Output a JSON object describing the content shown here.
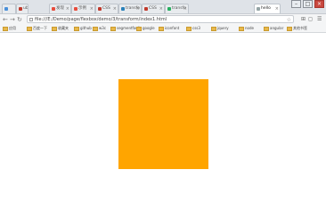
{
  "window": {
    "controls": [
      "–",
      "□",
      "×"
    ]
  },
  "tabs": [
    {
      "label": "",
      "favicon_color": "#4a90d9"
    },
    {
      "label": "ubu",
      "favicon_color": "#c0392b"
    },
    {
      "label": "发现",
      "favicon_color": "#e74c3c"
    },
    {
      "label": "示例",
      "favicon_color": "#e74c3c"
    },
    {
      "label": "CSS",
      "favicon_color": "#c0392b"
    },
    {
      "label": "transfo",
      "favicon_color": "#2980b9"
    },
    {
      "label": "CSS",
      "favicon_color": "#c0392b"
    },
    {
      "label": "transfo",
      "favicon_color": "#27ae60"
    },
    {
      "label": "hello",
      "favicon_color": "#95a5a6",
      "active": true
    }
  ],
  "address": {
    "url": "file:///E:/Demo/page/flexbox/demo/3/transform/index1.html"
  },
  "bookmarks": [
    "应用",
    "百度一下",
    "收藏夹",
    "github",
    "w3c",
    "segmentfault",
    "google",
    "iconfont",
    "css3",
    "jquery",
    "node",
    "angular",
    "其他书签"
  ],
  "square": {
    "color": "#ffa500"
  }
}
